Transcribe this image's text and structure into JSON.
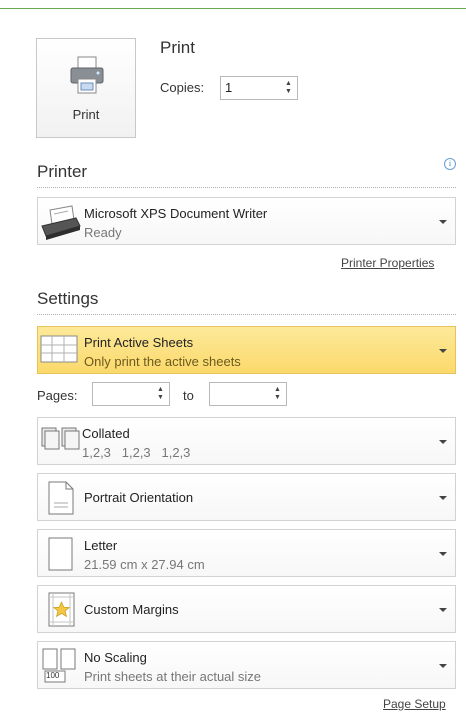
{
  "print": {
    "button_label": "Print",
    "title": "Print",
    "copies_label": "Copies:",
    "copies_value": "1"
  },
  "printer": {
    "heading": "Printer",
    "name": "Microsoft XPS Document Writer",
    "status": "Ready",
    "properties_link": "Printer Properties"
  },
  "settings": {
    "heading": "Settings",
    "print_what": {
      "main": "Print Active Sheets",
      "sub": "Only print the active sheets"
    },
    "pages_label": "Pages:",
    "to_label": "to",
    "pages_from": "",
    "pages_to": "",
    "collation": {
      "main": "Collated",
      "sub": "1,2,3   1,2,3   1,2,3"
    },
    "orientation": {
      "main": "Portrait Orientation"
    },
    "paper": {
      "main": "Letter",
      "sub": "21.59 cm x 27.94 cm"
    },
    "margins": {
      "main": "Custom Margins"
    },
    "scaling": {
      "main": "No Scaling",
      "sub": "Print sheets at their actual size",
      "icon_text": "100"
    },
    "page_setup_link": "Page Setup"
  },
  "colors": {
    "active_fill": "#fbd96c",
    "top_rule": "#6aa84f"
  }
}
